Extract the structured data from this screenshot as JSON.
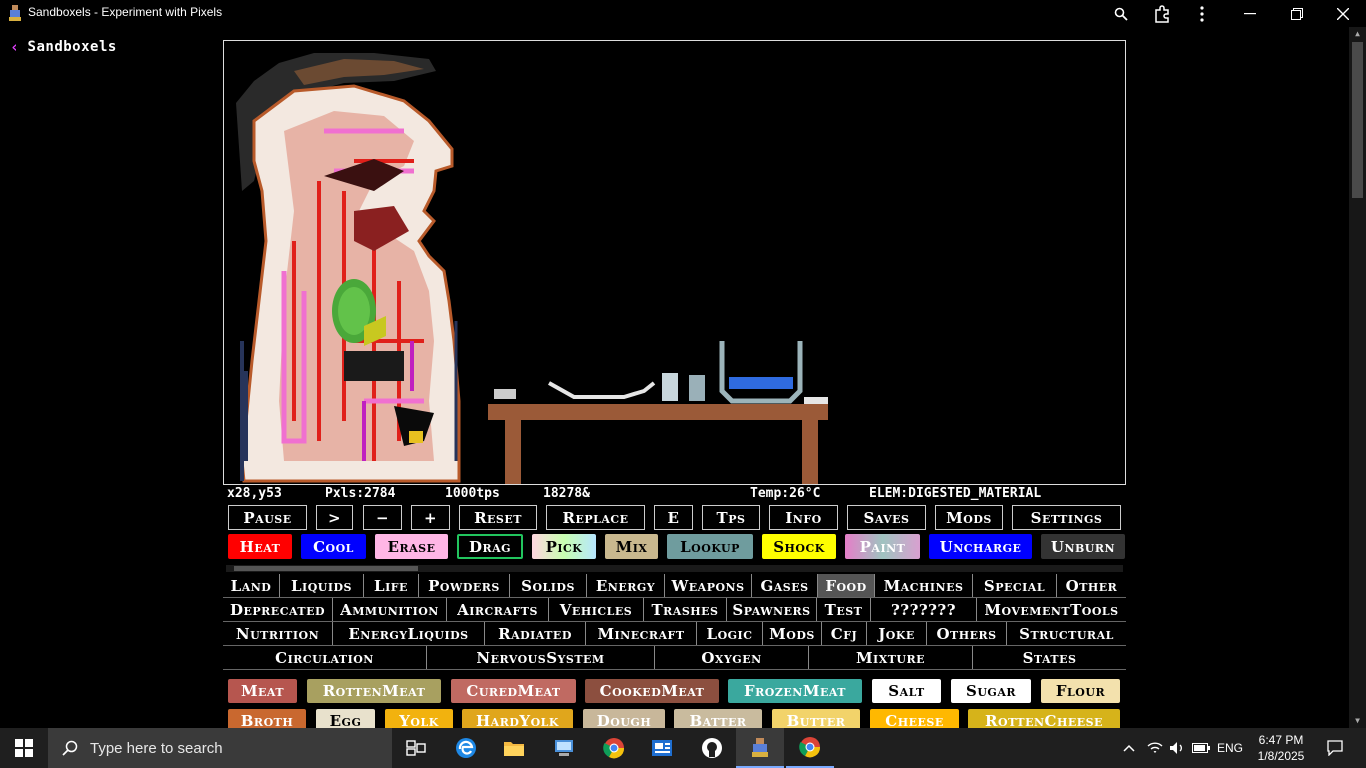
{
  "window": {
    "title": "Sandboxels - Experiment with Pixels"
  },
  "header": {
    "back_label": "Sandboxels"
  },
  "stats": {
    "coords": "x28,y53",
    "pixels": "Pxls:2784",
    "tps": "1000tps",
    "ticks": "18278&",
    "temp": "Temp:26°C",
    "elem": "ELEM:DIGESTED_MATERIAL"
  },
  "controls": [
    "Pause",
    ">",
    "−",
    "+",
    "Reset",
    "Replace",
    "E",
    "Tps",
    "Info",
    "Saves",
    "Mods",
    "Settings"
  ],
  "tools": [
    {
      "label": "Heat",
      "bg": "#ff0000",
      "fg": "#ffffff"
    },
    {
      "label": "Cool",
      "bg": "#0000ff",
      "fg": "#ffffff"
    },
    {
      "label": "Erase",
      "bg": "#ffb6e6",
      "fg": "#000000"
    },
    {
      "label": "Drag",
      "bg": "#000000",
      "fg": "#ffffff"
    },
    {
      "label": "Pick",
      "bg": "#c8ffb0",
      "fg": "#000000"
    },
    {
      "label": "Mix",
      "bg": "#c9b88e",
      "fg": "#000000"
    },
    {
      "label": "Lookup",
      "bg": "#6f9c9e",
      "fg": "#000000"
    },
    {
      "label": "Shock",
      "bg": "#ffff00",
      "fg": "#000000"
    },
    {
      "label": "Paint",
      "bg": "#d58ac5",
      "fg": "#ffffff"
    },
    {
      "label": "Uncharge",
      "bg": "#0000ff",
      "fg": "#ffffff"
    },
    {
      "label": "Unburn",
      "bg": "#333333",
      "fg": "#ffffff"
    }
  ],
  "categories": {
    "row1": [
      "Land",
      "Liquids",
      "Life",
      "Powders",
      "Solids",
      "Energy",
      "Weapons",
      "Gases",
      "Food",
      "Machines",
      "Special",
      "Other"
    ],
    "row2": [
      "Deprecated",
      "Ammunition",
      "Aircrafts",
      "Vehicles",
      "Trashes",
      "Spawners",
      "Test",
      "???????",
      "MovementTools"
    ],
    "row3": [
      "Nutrition",
      "EnergyLiquids",
      "Radiated",
      "Minecraft",
      "Logic",
      "Mods",
      "Cfj",
      "Joke",
      "Others",
      "Structural"
    ],
    "row4": [
      "Circulation",
      "NervousSystem",
      "Oxygen",
      "Mixture",
      "States"
    ],
    "selected": "Food"
  },
  "elements": {
    "row1": [
      {
        "label": "Meat",
        "bg": "#b6564f",
        "fg": "#ffffff"
      },
      {
        "label": "RottenMeat",
        "bg": "#a8a060",
        "fg": "#ffffff"
      },
      {
        "label": "CuredMeat",
        "bg": "#c06a62",
        "fg": "#ffffff"
      },
      {
        "label": "CookedMeat",
        "bg": "#8c4f3f",
        "fg": "#ffffff"
      },
      {
        "label": "FrozenMeat",
        "bg": "#3aa89e",
        "fg": "#ffffff"
      },
      {
        "label": "Salt",
        "bg": "#ffffff",
        "fg": "#000000"
      },
      {
        "label": "Sugar",
        "bg": "#ffffff",
        "fg": "#000000"
      },
      {
        "label": "Flour",
        "bg": "#f3e1ad",
        "fg": "#000000"
      }
    ],
    "row2": [
      {
        "label": "Broth",
        "bg": "#c9682f",
        "fg": "#ffffff"
      },
      {
        "label": "Egg",
        "bg": "#e8e1cc",
        "fg": "#000000"
      },
      {
        "label": "Yolk",
        "bg": "#f2b20e",
        "fg": "#ffffff"
      },
      {
        "label": "HardYolk",
        "bg": "#e0a61c",
        "fg": "#ffffff"
      },
      {
        "label": "Dough",
        "bg": "#c8b79a",
        "fg": "#ffffff"
      },
      {
        "label": "Batter",
        "bg": "#c9bb9e",
        "fg": "#ffffff"
      },
      {
        "label": "Butter",
        "bg": "#f2d36a",
        "fg": "#ffffff"
      },
      {
        "label": "Cheese",
        "bg": "#ffb800",
        "fg": "#ffffff"
      },
      {
        "label": "RottenCheese",
        "bg": "#d6b31a",
        "fg": "#ffffff"
      }
    ]
  },
  "taskbar": {
    "search_placeholder": "Type here to search",
    "lang": "ENG",
    "time": "6:47 PM",
    "date": "1/8/2025"
  }
}
